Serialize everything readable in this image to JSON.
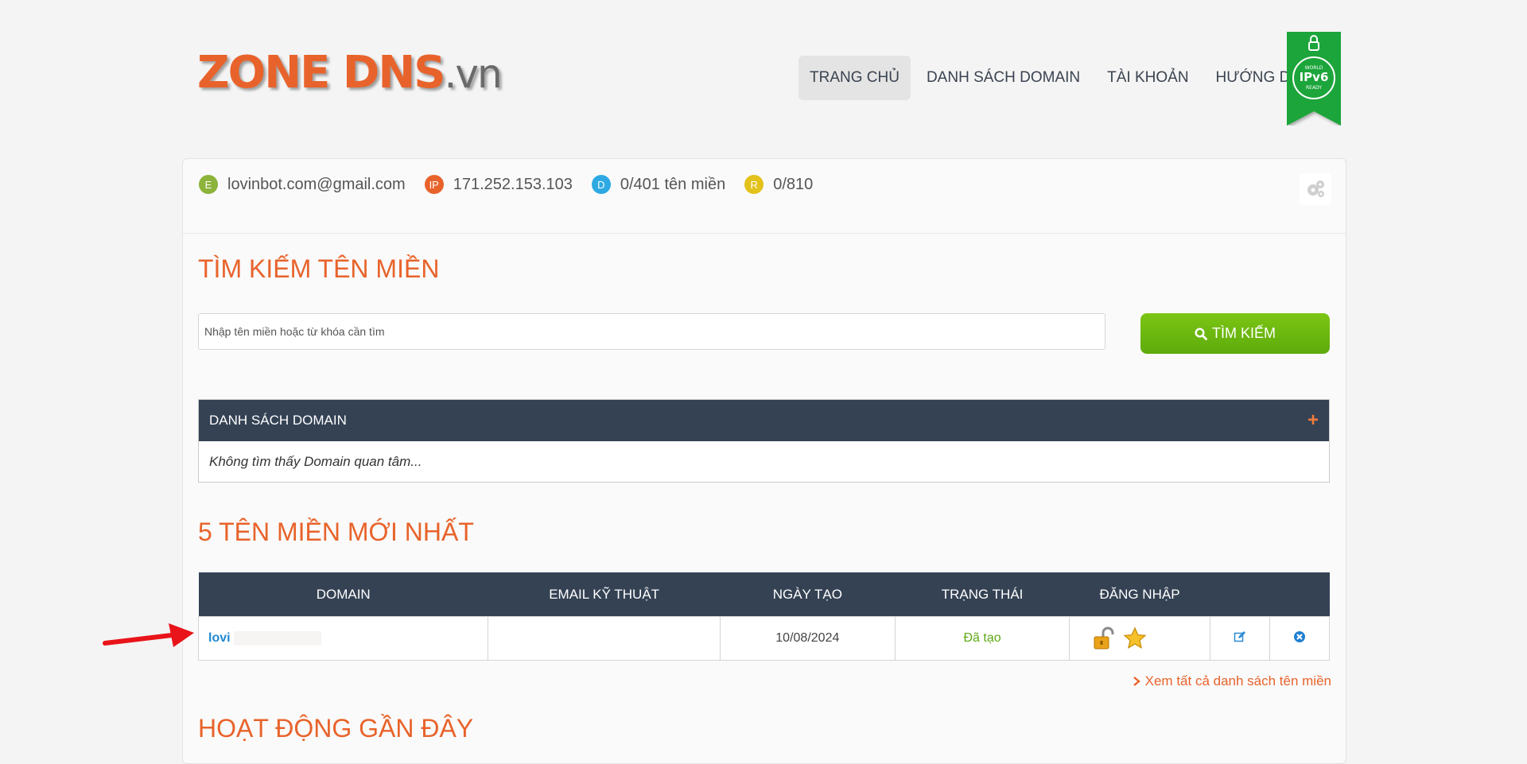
{
  "header": {
    "logo_zone": "ZONE",
    "logo_dns": "DNS",
    "logo_tld": ".vn",
    "nav": [
      {
        "label": "TRANG CHỦ",
        "active": true
      },
      {
        "label": "DANH SÁCH DOMAIN"
      },
      {
        "label": "TÀI KHOẢN"
      },
      {
        "label": "HƯỚNG DẪN"
      }
    ],
    "ipv6_badge": {
      "small": "WORLD",
      "main": "IPv6",
      "sub": "READY"
    }
  },
  "info_bar": {
    "email": {
      "badge": "E",
      "value": "lovinbot.com@gmail.com",
      "color": "#8cb33a"
    },
    "ip": {
      "badge": "IP",
      "value": "171.252.153.103",
      "color": "#e8632b"
    },
    "domains": {
      "badge": "D",
      "value": "0/401 tên miền",
      "color": "#2ea9e3"
    },
    "records": {
      "badge": "R",
      "value": "0/810",
      "color": "#e3c21c"
    }
  },
  "search": {
    "title": "TÌM KIẾM TÊN MIỀN",
    "placeholder": "Nhập tên miền hoặc từ khóa cần tìm",
    "button_label": "TÌM KIẾM"
  },
  "domain_list": {
    "header": "DANH SÁCH DOMAIN",
    "plus": "+",
    "empty": "Không tìm thấy Domain quan tâm..."
  },
  "latest": {
    "title": "5 TÊN MIỀN MỚI NHẤT",
    "columns": [
      "DOMAIN",
      "EMAIL KỸ THUẬT",
      "NGÀY TẠO",
      "TRẠNG THÁI",
      "ĐĂNG NHẬP",
      "",
      ""
    ],
    "rows": [
      {
        "domain": "lovi",
        "email": "",
        "created": "10/08/2024",
        "status": "Đã tạo"
      }
    ],
    "view_all": "Xem tất cả danh sách tên miền"
  },
  "recent": {
    "title": "HOẠT ĐỘNG GẦN ĐÂY"
  },
  "colors": {
    "accent": "#e8632b",
    "header_bg": "#344254",
    "success": "#5ea814",
    "link": "#1e88d0"
  }
}
